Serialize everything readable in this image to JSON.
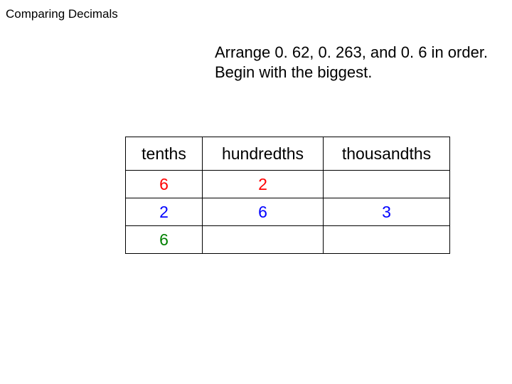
{
  "title": "Comparing Decimals",
  "prompt": {
    "line1": "Arrange 0. 62, 0. 263, and 0. 6 in order.",
    "line2": "Begin with the biggest."
  },
  "headers": {
    "tenths": "tenths",
    "hundredths": "hundredths",
    "thousandths": "thousandths"
  },
  "rows": [
    {
      "tenths": "6",
      "hundredths": "2",
      "thousandths": ""
    },
    {
      "tenths": "2",
      "hundredths": "6",
      "thousandths": "3"
    },
    {
      "tenths": "6",
      "hundredths": "",
      "thousandths": ""
    }
  ]
}
